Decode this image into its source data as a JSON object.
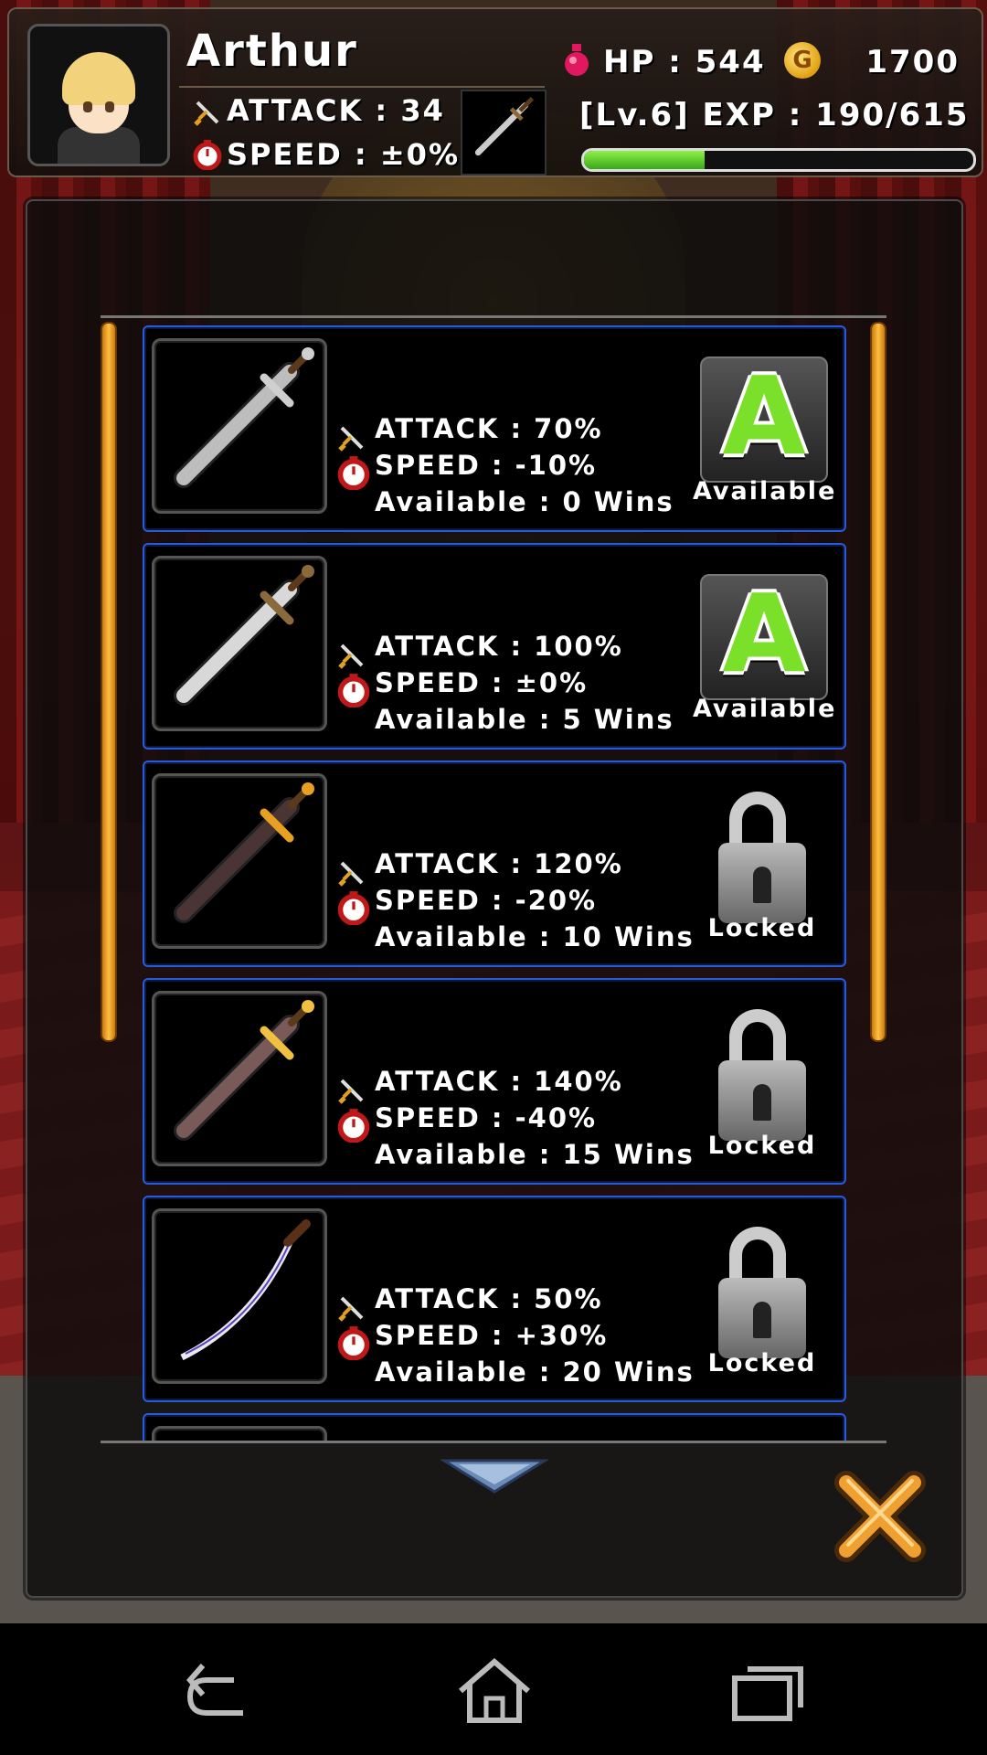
{
  "player": {
    "name": "Arthur",
    "attack": "ATTACK : 34",
    "speed": "SPEED : ±0%",
    "hp": "HP : 544",
    "gold": "1700",
    "coin_symbol": "G",
    "exp": "[Lv.6] EXP : 190/615",
    "exp_fraction": 0.31
  },
  "weapons": [
    {
      "attack": "ATTACK : 70%",
      "speed": "SPEED : -10%",
      "available": "Available : 0 Wins",
      "status": "Available",
      "state": "available",
      "icon": "steel-sword-icon",
      "blade": "#bdbdbd",
      "guard": "#cfcfcf"
    },
    {
      "attack": "ATTACK : 100%",
      "speed": "SPEED : ±0%",
      "available": "Available : 5 Wins",
      "status": "Available",
      "state": "available",
      "icon": "knight-sword-icon",
      "blade": "#d8d8d8",
      "guard": "#8a6a3a"
    },
    {
      "attack": "ATTACK : 120%",
      "speed": "SPEED : -20%",
      "available": "Available : 10 Wins",
      "status": "Locked",
      "state": "locked",
      "icon": "dark-sword-icon",
      "blade": "#4a3434",
      "guard": "#e8a020"
    },
    {
      "attack": "ATTACK : 140%",
      "speed": "SPEED : -40%",
      "available": "Available : 15 Wins",
      "status": "Locked",
      "state": "locked",
      "icon": "ornate-greatsword-icon",
      "blade": "#7a5a58",
      "guard": "#f0c040"
    },
    {
      "attack": "ATTACK : 50%",
      "speed": "SPEED : +30%",
      "available": "Available : 20 Wins",
      "status": "Locked",
      "state": "locked",
      "icon": "katana-icon",
      "blade": "#e8e8f0",
      "guard": "#5a3018"
    },
    {
      "attack": "",
      "speed": "",
      "available": "",
      "status": "",
      "state": "partial",
      "icon": "partial-weapon-icon",
      "blade": "#444",
      "guard": "#444"
    }
  ],
  "colors": {
    "card_border": "#2a5ad8",
    "available_green": "#7ae02a",
    "exp_green": "#5ccc2a",
    "rail_orange": "#ffb020",
    "close_orange": "#f0a030"
  },
  "icons": {
    "back": "back-arrow-icon",
    "home": "home-icon",
    "recents": "recent-apps-icon",
    "close": "close-x-icon",
    "scroll": "scroll-down-arrow-icon"
  }
}
